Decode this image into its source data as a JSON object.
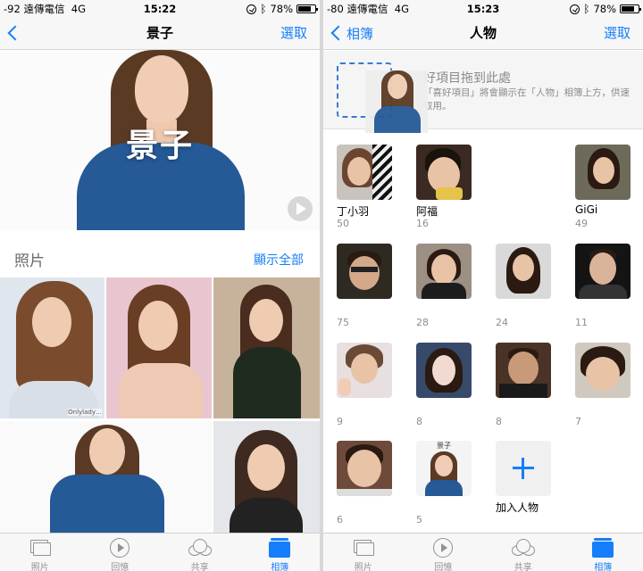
{
  "left": {
    "status": {
      "signal": "-92 遠傳電信",
      "network": "4G",
      "time": "15:22",
      "battery": "78%"
    },
    "nav": {
      "back_label": "",
      "title": "景子",
      "action": "選取"
    },
    "hero": {
      "name": "景子"
    },
    "section": {
      "title": "照片",
      "link": "顯示全部"
    },
    "photo_watermark": "Onlylady…"
  },
  "right": {
    "status": {
      "signal": "-80 遠傳電信",
      "network": "4G",
      "time": "15:23",
      "battery": "78%"
    },
    "nav": {
      "back_label": "相簿",
      "title": "人物",
      "action": "選取"
    },
    "favorites": {
      "title": "好項目拖到此處",
      "description": "「喜好項目」將會顯示在「人物」相簿上方，供速取用。"
    },
    "people": [
      {
        "name": "丁小羽",
        "count": "50"
      },
      {
        "name": "阿福",
        "count": "16"
      },
      {
        "name": "GiGi",
        "count": "49"
      },
      {
        "name": "",
        "count": "75"
      },
      {
        "name": "",
        "count": "28"
      },
      {
        "name": "",
        "count": "24"
      },
      {
        "name": "",
        "count": "11"
      },
      {
        "name": "",
        "count": "9"
      },
      {
        "name": "",
        "count": "8"
      },
      {
        "name": "",
        "count": "8"
      },
      {
        "name": "",
        "count": "7"
      },
      {
        "name": "",
        "count": "6"
      },
      {
        "name": "",
        "count": "5"
      }
    ],
    "dragged_label": "景子",
    "add_person": "加入人物"
  },
  "tabbar": [
    {
      "label": "照片",
      "icon": "photos-icon"
    },
    {
      "label": "回憶",
      "icon": "memories-icon"
    },
    {
      "label": "共享",
      "icon": "cloud-icon"
    },
    {
      "label": "相簿",
      "icon": "albums-icon",
      "active": true
    }
  ],
  "colors": {
    "accent": "#157efb",
    "hero_shirt": "#255a96",
    "tab_inactive": "#929292"
  }
}
